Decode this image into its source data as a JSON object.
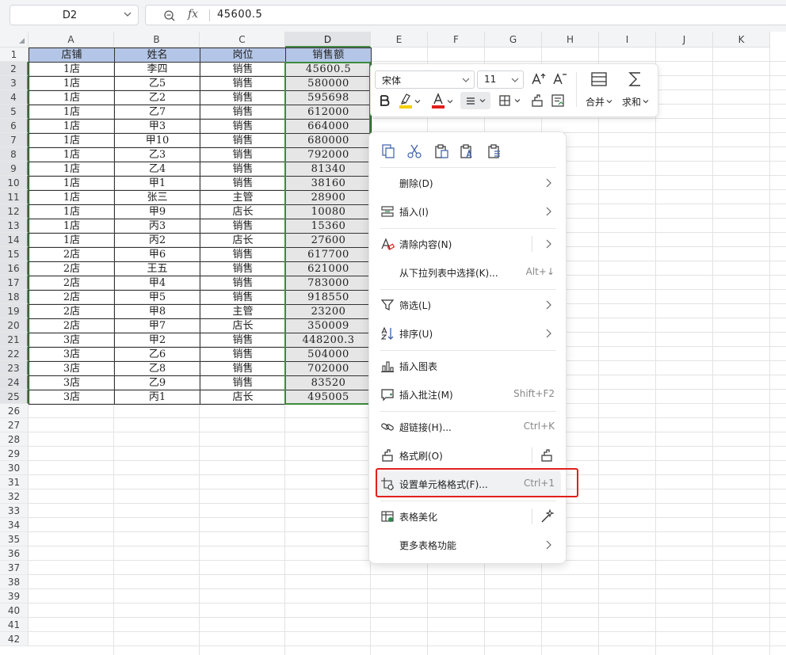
{
  "formula_bar": {
    "name_box": "D2",
    "fx_label": "fx",
    "value": "45600.5"
  },
  "columns": [
    "A",
    "B",
    "C",
    "D",
    "E",
    "F",
    "G",
    "H",
    "I",
    "J",
    "K"
  ],
  "selected_column": "D",
  "row_numbers": [
    "1",
    "2",
    "3",
    "4",
    "5",
    "6",
    "7",
    "8",
    "9",
    "10",
    "11",
    "12",
    "13",
    "14",
    "15",
    "16",
    "17",
    "18",
    "19",
    "20",
    "21",
    "22",
    "23",
    "24",
    "25",
    "26",
    "27",
    "28",
    "29",
    "30",
    "31",
    "32",
    "33",
    "34",
    "35",
    "36",
    "37",
    "38",
    "39",
    "40",
    "41",
    "42"
  ],
  "table": {
    "headers": [
      "店铺",
      "姓名",
      "岗位",
      "销售额"
    ],
    "rows": [
      [
        "1店",
        "李四",
        "销售",
        "45600.5"
      ],
      [
        "1店",
        "乙5",
        "销售",
        "580000"
      ],
      [
        "1店",
        "乙2",
        "销售",
        "595698"
      ],
      [
        "1店",
        "乙7",
        "销售",
        "612000"
      ],
      [
        "1店",
        "甲3",
        "销售",
        "664000"
      ],
      [
        "1店",
        "甲10",
        "销售",
        "680000"
      ],
      [
        "1店",
        "乙3",
        "销售",
        "792000"
      ],
      [
        "1店",
        "乙4",
        "销售",
        "81340"
      ],
      [
        "1店",
        "甲1",
        "销售",
        "38160"
      ],
      [
        "1店",
        "张三",
        "主管",
        "28900"
      ],
      [
        "1店",
        "甲9",
        "店长",
        "10080"
      ],
      [
        "1店",
        "丙3",
        "销售",
        "15360"
      ],
      [
        "1店",
        "丙2",
        "店长",
        "27600"
      ],
      [
        "2店",
        "甲6",
        "销售",
        "617700"
      ],
      [
        "2店",
        "王五",
        "销售",
        "621000"
      ],
      [
        "2店",
        "甲4",
        "销售",
        "783000"
      ],
      [
        "2店",
        "甲5",
        "销售",
        "918550"
      ],
      [
        "2店",
        "甲8",
        "主管",
        "23200"
      ],
      [
        "2店",
        "甲7",
        "店长",
        "350009"
      ],
      [
        "3店",
        "甲2",
        "销售",
        "448200.3"
      ],
      [
        "3店",
        "乙6",
        "销售",
        "504000"
      ],
      [
        "3店",
        "乙8",
        "销售",
        "702000"
      ],
      [
        "3店",
        "乙9",
        "销售",
        "83520"
      ],
      [
        "3店",
        "丙1",
        "店长",
        "495005"
      ]
    ]
  },
  "mini_toolbar": {
    "font_name": "宋体",
    "font_size": "11",
    "merge_label": "合并",
    "sum_label": "求和",
    "highlight_color": "#f5d000",
    "font_color": "#e0201e"
  },
  "context_menu": {
    "clipboard_icons": [
      "copy-icon",
      "cut-icon",
      "paste-icon",
      "paste-text-icon",
      "paste-special-icon"
    ],
    "items": [
      {
        "label": "删除(D)",
        "shortcut": "",
        "submenu": true,
        "icon": ""
      },
      {
        "label": "插入(I)",
        "shortcut": "",
        "submenu": true,
        "icon": "insert-icon"
      },
      {
        "label": "清除内容(N)",
        "shortcut": "",
        "submenu": true,
        "icon": "clear-content-icon"
      },
      {
        "label": "从下拉列表中选择(K)...",
        "shortcut": "Alt+↓",
        "submenu": false,
        "icon": ""
      },
      {
        "label": "筛选(L)",
        "shortcut": "",
        "submenu": true,
        "icon": "filter-icon"
      },
      {
        "label": "排序(U)",
        "shortcut": "",
        "submenu": true,
        "icon": "sort-icon"
      },
      {
        "label": "插入图表",
        "shortcut": "",
        "submenu": false,
        "icon": "chart-icon"
      },
      {
        "label": "插入批注(M)",
        "shortcut": "Shift+F2",
        "submenu": false,
        "icon": "comment-icon"
      },
      {
        "label": "超链接(H)...",
        "shortcut": "Ctrl+K",
        "submenu": false,
        "icon": "link-icon"
      },
      {
        "label": "格式刷(O)",
        "shortcut": "",
        "submenu": false,
        "icon": "format-painter-icon"
      },
      {
        "label": "设置单元格格式(F)...",
        "shortcut": "Ctrl+1",
        "submenu": false,
        "icon": "cell-format-icon"
      },
      {
        "label": "表格美化",
        "shortcut": "",
        "submenu": false,
        "icon": "table-beautify-icon"
      },
      {
        "label": "更多表格功能",
        "shortcut": "",
        "submenu": true,
        "icon": ""
      }
    ],
    "highlighted_item": "设置单元格格式(F)..."
  }
}
